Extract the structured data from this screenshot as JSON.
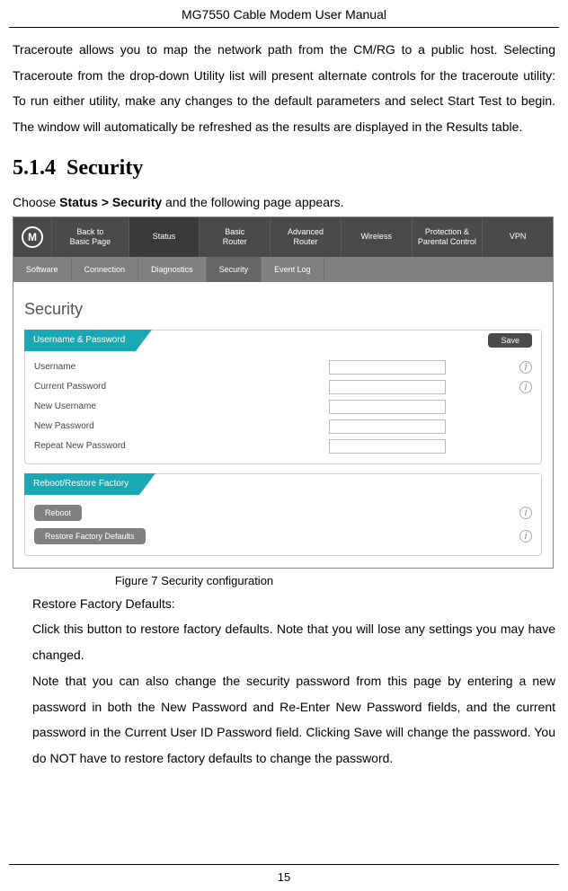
{
  "header": "MG7550 Cable Modem User Manual",
  "para1": "Traceroute allows you to map the network path from the CM/RG to a public host. Selecting Traceroute from the drop-down Utility list will present alternate controls for the traceroute utility: To run either utility, make any changes to the default parameters and select Start Test to begin.   The window will automatically be refreshed as the results are displayed in the Results table.",
  "sectionNumber": "5.1.4",
  "sectionTitle": "Security",
  "chooseText_prefix": "Choose ",
  "chooseText_bold": "Status > Security",
  "chooseText_suffix": " and the following page appears.",
  "screenshot": {
    "logo": "M",
    "nav": {
      "back1": "Back to",
      "back2": "Basic Page",
      "status": "Status",
      "basic1": "Basic",
      "basic2": "Router",
      "adv1": "Advanced",
      "adv2": "Router",
      "wireless": "Wireless",
      "prot1": "Protection &",
      "prot2": "Parental Control",
      "vpn": "VPN"
    },
    "subnav": {
      "software": "Software",
      "connection": "Connection",
      "diagnostics": "Diagnostics",
      "security": "Security",
      "eventlog": "Event Log"
    },
    "pageTitle": "Security",
    "panel1": {
      "title": "Username & Password",
      "save": "Save",
      "rows": {
        "username": "Username",
        "currentPassword": "Current Password",
        "newUsername": "New Username",
        "newPassword": "New Password",
        "repeatNewPassword": "Repeat New Password"
      }
    },
    "panel2": {
      "title": "Reboot/Restore Factory",
      "reboot": "Reboot",
      "restore": "Restore Factory Defaults"
    }
  },
  "figureCaption": "Figure 7 Security configuration",
  "restoreTitle": "Restore Factory Defaults:",
  "restorePara": "Click this button to restore factory defaults. Note that you will lose any settings you may have changed.",
  "notePara": "Note that you can also change the security password from this page by entering a new password in both the New Password and Re-Enter New Password fields, and the current password in the Current User ID Password field. Clicking Save will change the password. You do NOT have to restore factory defaults to change the password.",
  "pageNumber": "15"
}
